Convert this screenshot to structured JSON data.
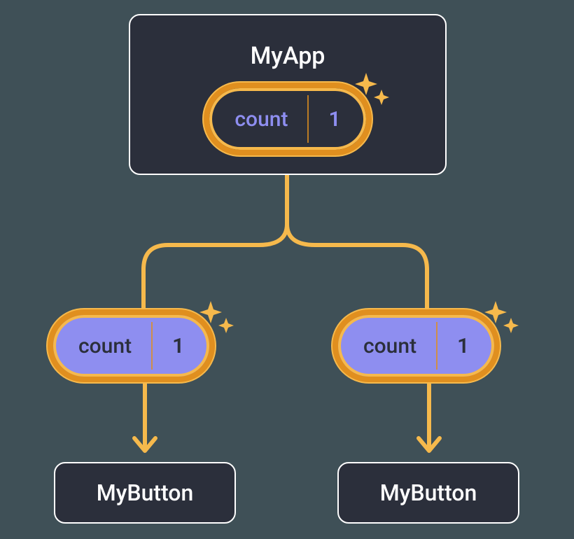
{
  "parent": {
    "title": "MyApp",
    "state_label": "count",
    "state_value": "1"
  },
  "props": {
    "left": {
      "label": "count",
      "value": "1"
    },
    "right": {
      "label": "count",
      "value": "1"
    }
  },
  "children": {
    "left": {
      "title": "MyButton"
    },
    "right": {
      "title": "MyButton"
    }
  },
  "colors": {
    "bg": "#3f5057",
    "box": "#2b2f3b",
    "border": "#ffffff",
    "pill_border": "#e08f1f",
    "pill_glow": "#f6b94c",
    "accent": "#8e8ef0",
    "connector": "#f6b94c"
  }
}
